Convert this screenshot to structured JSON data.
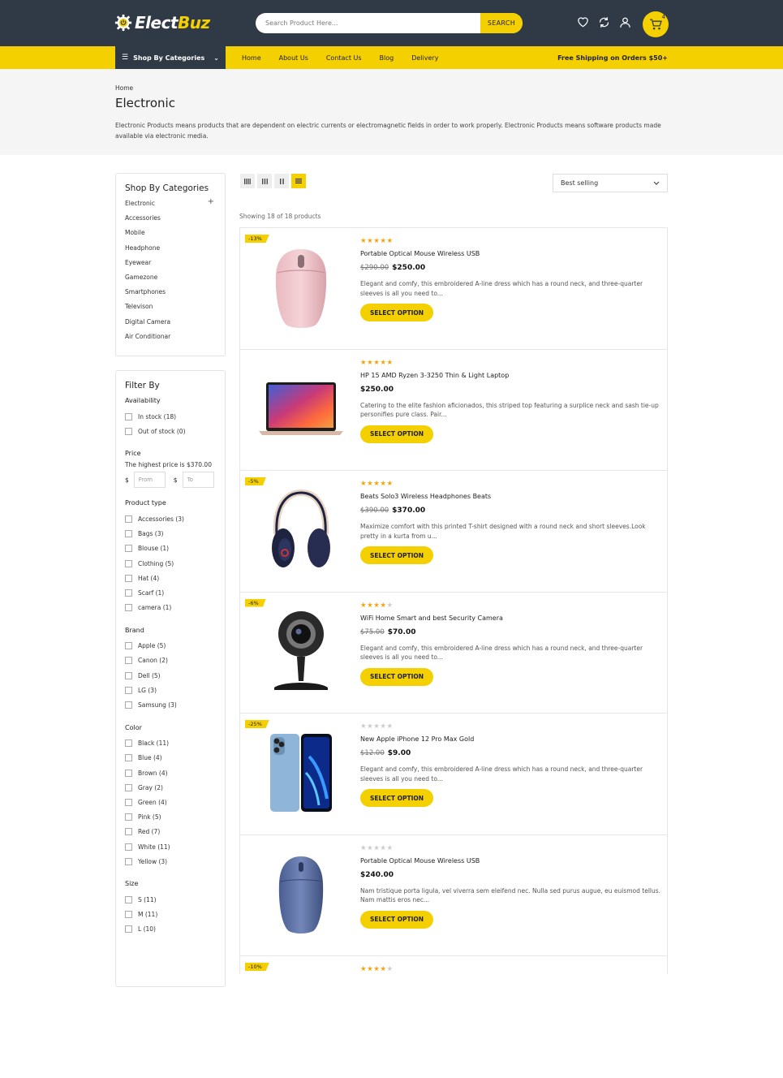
{
  "header": {
    "logo_text_a": "Elect",
    "logo_text_b": "Buz",
    "search_placeholder": "Search Product Here...",
    "search_button": "SEARCH",
    "cart_count": "4",
    "icons": [
      "heart-icon",
      "refresh-icon",
      "user-icon",
      "cart-icon"
    ]
  },
  "nav": {
    "categories_label": "Shop By Categories",
    "links": [
      "Home",
      "About Us",
      "Contact Us",
      "Blog",
      "Delivery"
    ],
    "shipping": "Free Shipping on Orders $50+"
  },
  "hero": {
    "breadcrumb": "Home",
    "title": "Electronic",
    "description": "Electronic Products means products that are dependent on electric currents or electromagnetic fields in order to work properly. Electronic Products means software products made available via electronic media."
  },
  "sidebar": {
    "categories_title": "Shop By Categories",
    "categories": [
      "Electronic",
      "Accessories",
      "Mobile",
      "Headphone",
      "Eyewear",
      "Gamezone",
      "Smartphones",
      "Televison",
      "Digital Camera",
      "Air Conditionar"
    ],
    "filter_title": "Filter By",
    "availability": {
      "title": "Availability",
      "options": [
        "In stock (18)",
        "Out of stock (0)"
      ]
    },
    "price": {
      "title": "Price",
      "note": "The highest price is $370.00",
      "currency": "$",
      "from_placeholder": "From",
      "to_placeholder": "To"
    },
    "product_type": {
      "title": "Product type",
      "options": [
        "Accessories (3)",
        "Bags (3)",
        "Blouse (1)",
        "Clothing (5)",
        "Hat (4)",
        "Scarf (1)",
        "camera (1)"
      ]
    },
    "brand": {
      "title": "Brand",
      "options": [
        "Apple (5)",
        "Canon (2)",
        "Dell (5)",
        "LG (3)",
        "Samsung (3)"
      ]
    },
    "color": {
      "title": "Color",
      "options": [
        "Black (11)",
        "Blue (4)",
        "Brown (4)",
        "Gray (2)",
        "Green (4)",
        "Pink (5)",
        "Red (7)",
        "White (11)",
        "Yellow (3)"
      ]
    },
    "size": {
      "title": "Size",
      "options": [
        "S (11)",
        "M (11)",
        "L (10)"
      ]
    }
  },
  "toolbar": {
    "sort_value": "Best selling",
    "showing": "Showing 18 of 18 products",
    "accent": "#f5d000"
  },
  "products": [
    {
      "badge": "-13%",
      "rating": 5,
      "name": "Portable Optical Mouse Wireless USB",
      "old_price": "$290.00",
      "price": "$250.00",
      "desc": "Elegant and comfy, this embroidered A-line dress which has a round neck, and three-quarter sleeves is all you need to...",
      "button": "SELECT OPTION",
      "image": "pink-mouse"
    },
    {
      "badge": "",
      "rating": 5,
      "name": "HP 15 AMD Ryzen 3-3250 Thin & Light Laptop",
      "old_price": "",
      "price": "$250.00",
      "desc": "Catering to the elite fashion aficionados, this striped top featuring a surplice neck and sash tie-up personifies pure class. Pair...",
      "button": "SELECT OPTION",
      "image": "laptop"
    },
    {
      "badge": "-5%",
      "rating": 5,
      "name": "Beats Solo3 Wireless Headphones Beats",
      "old_price": "$390.00",
      "price": "$370.00",
      "desc": "Maximize comfort with this printed T-shirt designed with a round neck and short sleeves.Look pretty in a kurta from u...",
      "button": "SELECT OPTION",
      "image": "headphones"
    },
    {
      "badge": "-6%",
      "rating": 4,
      "name": "WiFi Home Smart and best Security Camera",
      "old_price": "$75.00",
      "price": "$70.00",
      "desc": "Elegant and comfy, this embroidered A-line dress which has a round neck, and three-quarter sleeves is all you need to...",
      "button": "SELECT OPTION",
      "image": "camera"
    },
    {
      "badge": "-25%",
      "rating": 0,
      "name": "New Apple iPhone 12 Pro Max Gold",
      "old_price": "$12.00",
      "price": "$9.00",
      "desc": "Elegant and comfy, this embroidered A-line dress which has a round neck, and three-quarter sleeves is all you need to...",
      "button": "SELECT OPTION",
      "image": "iphone"
    },
    {
      "badge": "",
      "rating": 0,
      "name": "Portable Optical Mouse Wireless USB",
      "old_price": "",
      "price": "$240.00",
      "desc": "Nam tristique porta ligula, vel viverra sem eleifend nec. Nulla sed purus augue, eu euismod tellus. Nam mattis eros nec...",
      "button": "SELECT OPTION",
      "image": "blue-mouse"
    },
    {
      "badge": "-10%",
      "rating": 4,
      "name": "",
      "old_price": "",
      "price": "",
      "desc": "",
      "button": "",
      "image": ""
    }
  ]
}
